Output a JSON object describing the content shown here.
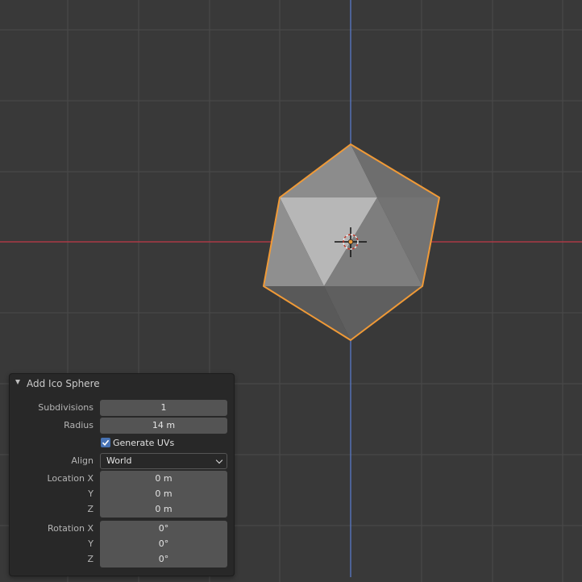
{
  "viewport": {
    "colors": {
      "background": "#393939",
      "x_axis": "#c13a48",
      "y_axis": "#5b7fd4",
      "selection_outline": "#f09a37"
    },
    "object_icon": "origin-cursor-icon"
  },
  "operator_panel": {
    "title": "Add Ico Sphere",
    "subdivisions": {
      "label": "Subdivisions",
      "value": "1"
    },
    "radius": {
      "label": "Radius",
      "value": "14 m"
    },
    "generate_uvs": {
      "label": "Generate UVs",
      "checked": true
    },
    "align": {
      "label": "Align",
      "value": "World"
    },
    "location": {
      "label_x": "Location X",
      "label_y": "Y",
      "label_z": "Z",
      "x": "0 m",
      "y": "0 m",
      "z": "0 m"
    },
    "rotation": {
      "label_x": "Rotation X",
      "label_y": "Y",
      "label_z": "Z",
      "x": "0°",
      "y": "0°",
      "z": "0°"
    }
  }
}
